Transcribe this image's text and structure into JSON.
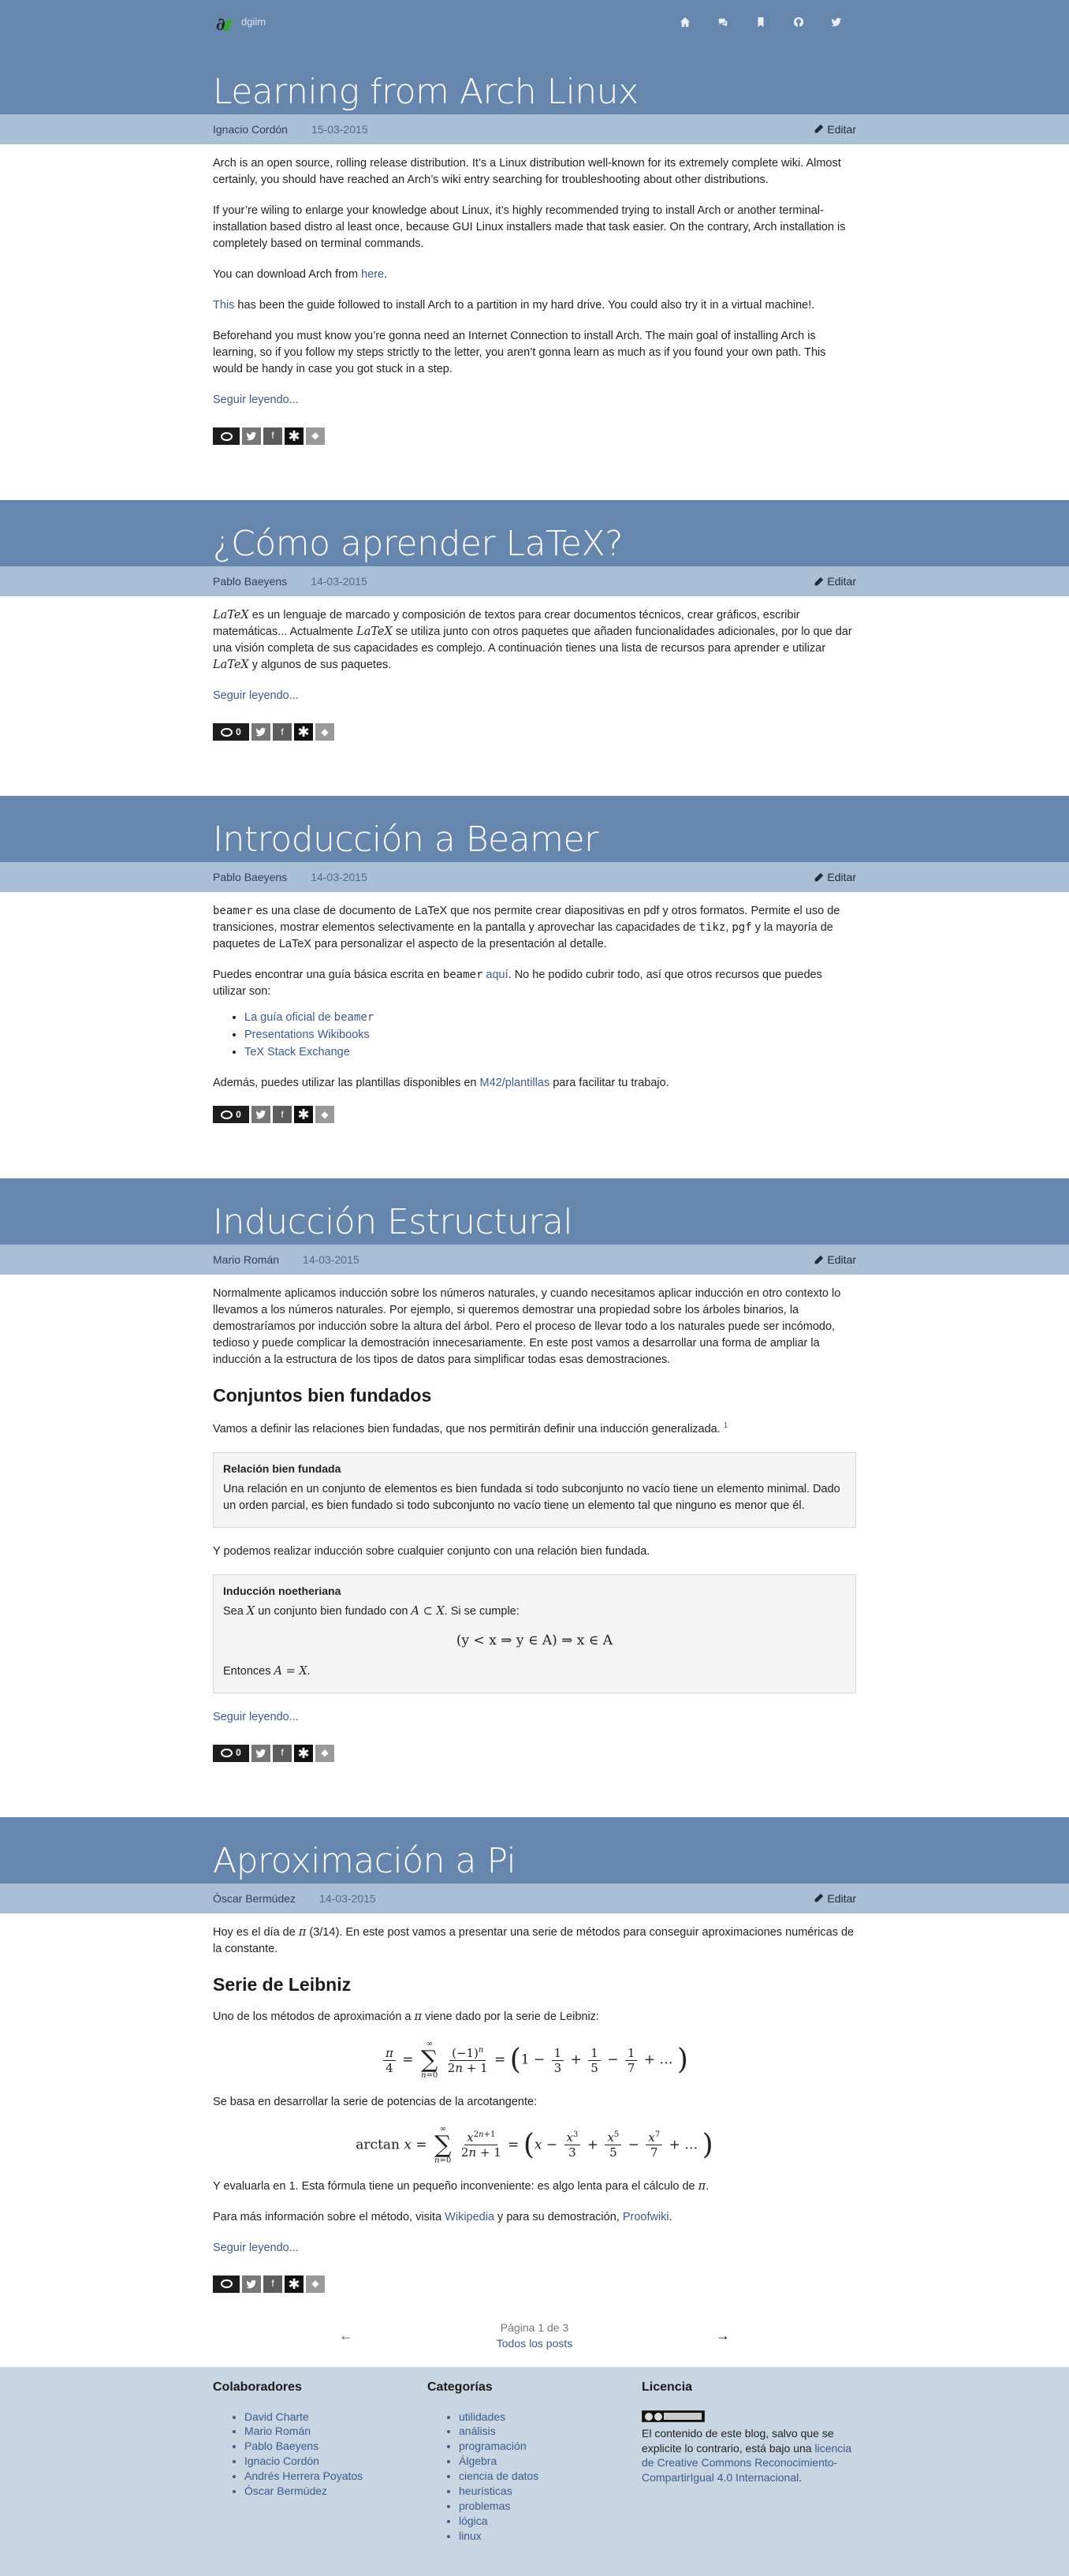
{
  "site": {
    "name": "dgiim"
  },
  "nav_icons": [
    "home-icon",
    "chat-icon",
    "bookmark-icon",
    "github-icon",
    "twitter-icon"
  ],
  "edit_label": "Editar",
  "read_more": "Seguir leyendo...",
  "posts": [
    {
      "title": "Learning from Arch Linux",
      "author": "Ignacio Cordón",
      "date": "15-03-2015",
      "comments": "",
      "p1": "Arch is an open source, rolling release distribution. It’s a Linux distribution well-known for its extremely complete wiki. Almost certainly, you should have reached an Arch’s wiki entry searching for troubleshooting about other distributions.",
      "p2": "If your’re wiling to enlarge your knowledge about Linux, it’s highly recommended trying to install Arch or another terminal-installation based distro al least once, because GUI Linux installers made that task easier. On the contrary, Arch installation is completely based on terminal commands.",
      "p3_pre": "You can download Arch from ",
      "p3_link": "here",
      "p3_post": ".",
      "p4_link": "This",
      "p4_post": " has been the guide followed to install Arch to a partition in my hard drive. You could also try it in a virtual machine!.",
      "p5": "Beforehand you must know you’re gonna need an Internet Connection to install Arch. The main goal of installing Arch is learning, so if you follow my steps strictly to the letter, you aren’t gonna learn as much as if you found your own path. This would be handy in case you got stuck in a step."
    },
    {
      "title": "¿Cómo aprender LaTeX?",
      "author": "Pablo Baeyens",
      "date": "14-03-2015",
      "comments": "0",
      "latex": "LaTeX",
      "p1a": " es un lenguaje de marcado y composición de textos para crear documentos técnicos, crear gráficos, escribir matemáticas... Actualmente ",
      "p1b": " se utiliza junto con otros paquetes que añaden funcionalidades adicionales, por lo que dar una visión completa de sus capacidades es complejo. A continuación tienes una lista de recursos para aprender e utilizar ",
      "p1c": " y algunos de sus paquetes."
    },
    {
      "title": "Introducción a Beamer",
      "author": "Pablo Baeyens",
      "date": "14-03-2015",
      "comments": "0",
      "beamer": "beamer",
      "p1a": " es una clase de documento de LaTeX que nos permite crear diapositivas en pdf y otros formatos. Permite el uso de transiciones, mostrar elementos selectivamente en la pantalla y aprovechar las capacidades de ",
      "tikz": "tikz",
      "comma": ", ",
      "pgf": "pgf",
      "p1b": " y la mayoría de paquetes de LaTeX para personalizar el aspecto de la presentación al detalle.",
      "p2a": "Puedes encontrar una guía básica escrita en ",
      "p2_link": "aquí",
      "p2b": ". No he podido cubrir todo, así que otros recursos que puedes utilizar son:",
      "list": [
        "La guía oficial de ",
        "Presentations Wikibooks",
        "TeX Stack Exchange"
      ],
      "p3a": "Además, puedes utilizar las plantillas disponibles en ",
      "p3_link": "M42/plantillas",
      "p3b": " para facilitar tu trabajo."
    },
    {
      "title": "Inducción Estructural",
      "author": "Mario Román",
      "date": "14-03-2015",
      "comments": "0",
      "p1": "Normalmente aplicamos inducción sobre los números naturales, y cuando necesitamos aplicar inducción en otro contexto lo llevamos a los números naturales. Por ejemplo, si queremos demostrar una propiedad sobre los árboles binarios, la demostraríamos por inducción sobre la altura del árbol. Pero el proceso de llevar todo a los naturales puede ser incómodo, tedioso y puede complicar la demostración innecesariamente. En este post vamos a desarrollar una forma de ampliar la inducción a la estructura de los tipos de datos para simplificar todas esas demostraciones.",
      "h2": "Conjuntos bien fundados",
      "p2": "Vamos a definir las relaciones bien fundadas, que nos permitirán definir una inducción generalizada.",
      "fn": "1",
      "box1_title": "Relación bien fundada",
      "box1_text": "Una relación en un conjunto de elementos es bien fundada si todo subconjunto no vacío tiene un elemento minimal. Dado un orden parcial, es bien fundado si todo subconjunto no vacío tiene un elemento tal que ninguno es menor que él.",
      "p3": "Y podemos realizar inducción sobre cualquier conjunto con una relación bien fundada.",
      "box2_title": "Inducción noetheriana",
      "box2_a": "Sea ",
      "box2_X": "X",
      "box2_b": " un conjunto bien fundado con ",
      "box2_sub": "A ⊂ X",
      "box2_c": ". Si se cumple:",
      "box2_formula": "(y < x ⇒ y ∈ A) ⇒ x ∈ A",
      "box2_d": "Entonces ",
      "box2_eq": "A = X",
      "box2_e": "."
    },
    {
      "title": "Aproximación a Pi",
      "author": "Óscar Bermúdez",
      "date": "14-03-2015",
      "comments": "",
      "p1a": "Hoy es el día de ",
      "pi": "π",
      "p1b": " (3/14). En este post vamos a presentar una serie de métodos para conseguir aproximaciones numéricas de la constante.",
      "h2": "Serie de Leibniz",
      "p2a": "Uno de los métodos de aproximación a ",
      "p2b": " viene dado por la serie de Leibniz:",
      "p3": "Se basa en desarrollar la serie de potencias de la arcotangente:",
      "p4a": "Y evaluarla en 1. Esta fórmula tiene un pequeño inconveniente: es algo lenta para el cálculo de ",
      "p4b": ".",
      "p5a": "Para más información sobre el método, visita ",
      "p5_link1": "Wikipedia",
      "p5b": " y para su demostración, ",
      "p5_link2": "Proofwiki",
      "p5c": "."
    }
  ],
  "pager": {
    "page": "Página 1 de 3",
    "all": "Todos los posts"
  },
  "footer": {
    "col1_title": "Colaboradores",
    "col1": [
      "David Charte",
      "Mario Román",
      "Pablo Baeyens",
      "Ignacio Cordón",
      "Andrés Herrera Poyatos",
      "Óscar Bermúdez"
    ],
    "col2_title": "Categorías",
    "col2": [
      "utilidades",
      "análisis",
      "programación",
      "Álgebra",
      "ciencia de datos",
      "heurísticas",
      "problemas",
      "lógica",
      "linux"
    ],
    "col3_title": "Licencia",
    "lic_a": "El contenido de este blog, salvo que se explicite lo contrario, está bajo una ",
    "lic_link": "licencia de Creative Commons Reconocimiento-CompartirIgual 4.0 Internacional",
    "lic_b": "."
  }
}
